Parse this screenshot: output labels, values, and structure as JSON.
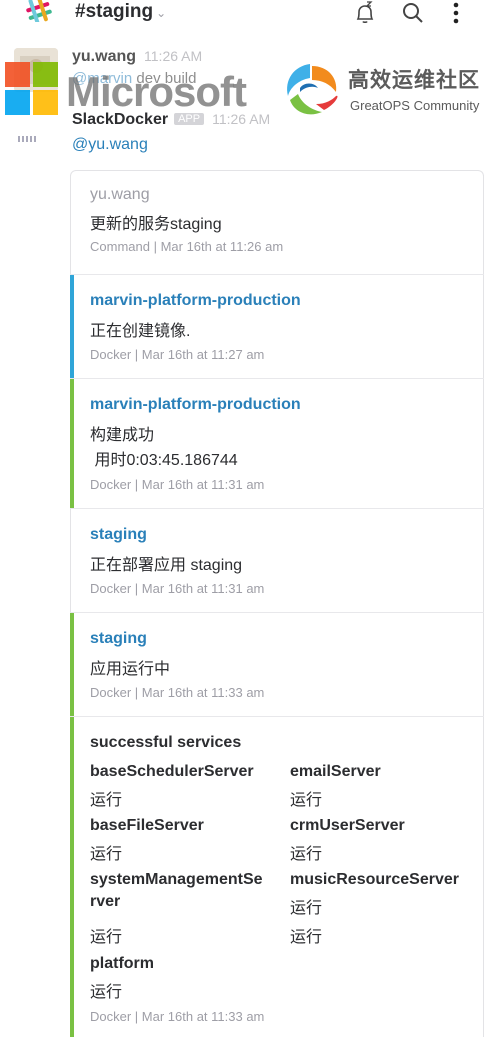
{
  "header": {
    "channel": "#staging",
    "chevron": "⌄",
    "icons": [
      "slack-logo",
      "snooze-bell-icon",
      "search-icon",
      "more-vertical-icon"
    ]
  },
  "watermark": {
    "ms_text": "Microsoft",
    "greatops_cn": "高效运维社区",
    "greatops_en": "GreatOPS Community"
  },
  "messages": [
    {
      "author": "yu.wang",
      "time": "11:26 AM",
      "mention": "@marvin",
      "text": " dev build"
    },
    {
      "author": "SlackDocker",
      "badge": "APP",
      "time": "11:26 AM",
      "mention": "@yu.wang"
    }
  ],
  "attachments": [
    {
      "title": "yu.wang",
      "lines": [
        "更新的服务staging"
      ],
      "footer": "Command | Mar 16th at 11:26 am",
      "color": ""
    },
    {
      "title": "marvin-platform-production",
      "lines": [
        "正在创建镜像."
      ],
      "footer": "Docker | Mar 16th at 11:27 am",
      "color": "#2fa5d8"
    },
    {
      "title": "marvin-platform-production",
      "lines": [
        "构建成功",
        " 用时0:03:45.186744"
      ],
      "footer": "Docker | Mar 16th at 11:31 am",
      "color": "#7ac143"
    },
    {
      "title": "staging",
      "lines": [
        "正在部署应用 staging"
      ],
      "footer": "Docker | Mar 16th at 11:31 am",
      "color": ""
    },
    {
      "title": "staging",
      "lines": [
        "应用运行中"
      ],
      "footer": "Docker | Mar 16th at 11:33 am",
      "color": "#7ac143"
    },
    {
      "title": "successful services",
      "fields": [
        {
          "title": "baseSchedulerServer",
          "value": "运行"
        },
        {
          "title": "emailServer",
          "value": "运行"
        },
        {
          "title": "baseFileServer",
          "value": "运行"
        },
        {
          "title": "crmUserServer",
          "value": "运行"
        },
        {
          "title": "systemManagementSe",
          "title2": "rver",
          "value": "运行"
        },
        {
          "title": "musicResourceServer",
          "value": "运行"
        },
        {
          "title": "platform",
          "value": "运行"
        }
      ],
      "extra_values": [
        "运行",
        "运行"
      ],
      "footer": "Docker | Mar 16th at 11:33 am",
      "color": "#7ac143"
    }
  ]
}
